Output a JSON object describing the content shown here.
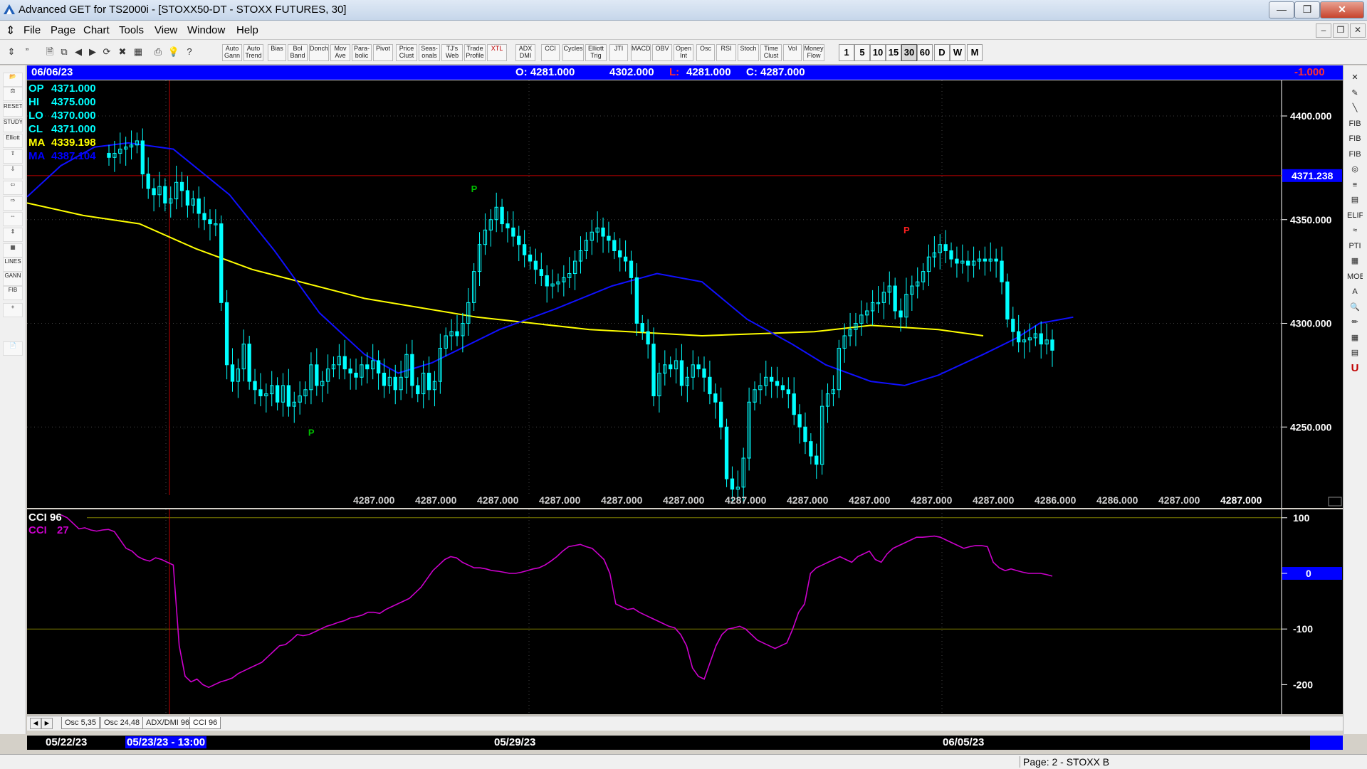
{
  "window": {
    "title": "Advanced GET for TS2000i - [STOXX50-DT - STOXX FUTURES, 30]",
    "minimize": "—",
    "restore": "❒",
    "close": "✕"
  },
  "menu": {
    "items": [
      "File",
      "Page",
      "Chart",
      "Tools",
      "View",
      "Window",
      "Help"
    ],
    "mdi_buttons": [
      "–",
      "❒",
      "✕"
    ]
  },
  "toolbar": {
    "study_buttons": [
      "Auto Gann",
      "Auto Trend",
      "Bias",
      "Bol Band",
      "Donch",
      "Mov Ave",
      "Para- bolic",
      "Pivot",
      "Price Clust",
      "Seas- onals",
      "TJ's Web",
      "Trade Profile",
      "XTL",
      "ADX DMI",
      "CCI",
      "Cycles",
      "Elliott Trig",
      "JTI",
      "MACD",
      "OBV",
      "Open Int",
      "Osc",
      "RSI",
      "Stoch",
      "Time Clust",
      "Vol",
      "Money Flow"
    ],
    "periods": [
      "1",
      "5",
      "10",
      "15",
      "30",
      "60",
      "D",
      "W",
      "M"
    ],
    "selected_period": "30"
  },
  "left_tools": [
    "📂",
    "⚖",
    "RESET",
    "STUDY",
    "Elliott",
    "⇧",
    "⇩",
    "⇦",
    "⇨",
    "⇔",
    "⇕",
    "▦",
    "LINES",
    "GANN",
    "FIB",
    "+",
    "📄"
  ],
  "right_tools": [
    "✕",
    "✎",
    "╲",
    "FIB RET",
    "FIB EXT",
    "FIB TIME",
    "◎",
    "≡",
    "▤",
    "ELIPS",
    "≈",
    "PTI",
    "▦",
    "MOB",
    "A",
    "🔍",
    "✏",
    "▦",
    "▤",
    "U"
  ],
  "infobar": {
    "date": "06/06/23",
    "open": "O: 4281.000",
    "high": "4302.000",
    "low_label": "L:",
    "low": "4281.000",
    "close": "C: 4287.000",
    "change": "-1.000"
  },
  "legend": [
    {
      "label": "OP",
      "value": "4371.000",
      "color": "#00ffff"
    },
    {
      "label": "HI",
      "value": "4375.000",
      "color": "#00ffff"
    },
    {
      "label": "LO",
      "value": "4370.000",
      "color": "#00ffff"
    },
    {
      "label": "CL",
      "value": "4371.000",
      "color": "#00ffff"
    },
    {
      "label": "MA",
      "value": "4339.198",
      "color": "#ffff00"
    },
    {
      "label": "MA",
      "value": "4387.104",
      "color": "#0000ff"
    }
  ],
  "colors": {
    "candle": "#00ffff",
    "ma_slow": "#ffff00",
    "ma_fast": "#1010ff",
    "cci": "#cc00cc",
    "pivot_low": "#00c000",
    "pivot_high": "#ff2020",
    "cursor": "#c00000",
    "grid": "#444444"
  },
  "price_axis": {
    "ticks": [
      "4400.000",
      "4350.000",
      "4300.000",
      "4250.000"
    ],
    "crosshair_label": "4371.238"
  },
  "bottom_values": [
    "4287.000",
    "4287.000",
    "4287.000",
    "4287.000",
    "4287.000",
    "4287.000",
    "4287.000",
    "4287.000",
    "4287.000",
    "4287.000",
    "4287.000",
    "4286.000",
    "4286.000",
    "4287.000",
    "4287.000"
  ],
  "pivots": {
    "low": "P",
    "high": "P"
  },
  "cci_panel": {
    "label1": "CCI 96",
    "label2": "CCI",
    "value2": "27",
    "ticks": [
      "100",
      "0",
      "-100",
      "-200"
    ],
    "zero_label": "0"
  },
  "tabs": {
    "nav_left": "◄",
    "nav_right": "►",
    "items": [
      "Osc 5,35",
      "Osc 24,48",
      "ADX/DMI 96",
      "CCI 96"
    ],
    "selected": "CCI 96"
  },
  "datebar": {
    "dates": [
      "05/22/23",
      "05/23/23 - 13:00",
      "05/29/23",
      "06/05/23"
    ]
  },
  "status": {
    "page": "Page: 2 - STOXX B"
  },
  "chart_data": {
    "type": "candlestick",
    "instrument": "STOXX50-DT",
    "ylim": [
      4210,
      4420
    ],
    "price_ticks": [
      4400,
      4350,
      4300,
      4250
    ],
    "crosshair_price": 4371.238,
    "closes": [
      4380,
      4382,
      4384,
      4385,
      4386,
      4388,
      4372,
      4365,
      4362,
      4366,
      4358,
      4360,
      4368,
      4364,
      4357,
      4360,
      4353,
      4350,
      4348,
      4348,
      4310,
      4280,
      4272,
      4278,
      4290,
      4272,
      4268,
      4265,
      4266,
      4270,
      4262,
      4270,
      4260,
      4262,
      4265,
      4268,
      4280,
      4270,
      4272,
      4278,
      4280,
      4284,
      4278,
      4276,
      4274,
      4280,
      4278,
      4282,
      4276,
      4270,
      4274,
      4268,
      4274,
      4285,
      4270,
      4266,
      4276,
      4268,
      4272,
      4288,
      4294,
      4296,
      4294,
      4300,
      4310,
      4325,
      4338,
      4345,
      4350,
      4356,
      4348,
      4346,
      4342,
      4338,
      4333,
      4330,
      4326,
      4323,
      4318,
      4319,
      4320,
      4322,
      4324,
      4330,
      4335,
      4340,
      4344,
      4346,
      4342,
      4340,
      4335,
      4332,
      4330,
      4322,
      4300,
      4296,
      4290,
      4265,
      4276,
      4280,
      4278,
      4282,
      4270,
      4274,
      4280,
      4278,
      4274,
      4266,
      4262,
      4250,
      4225,
      4220,
      4221,
      4235,
      4262,
      4268,
      4270,
      4274,
      4272,
      4270,
      4268,
      4266,
      4256,
      4250,
      4243,
      4236,
      4232,
      4260,
      4266,
      4268,
      4288,
      4294,
      4297,
      4300,
      4304,
      4306,
      4310,
      4310,
      4315,
      4318,
      4306,
      4303,
      4314,
      4318,
      4320,
      4325,
      4332,
      4334,
      4338,
      4335,
      4331,
      4329,
      4330,
      4328,
      4330,
      4331,
      4330,
      4331,
      4330,
      4320,
      4302,
      4296,
      4291,
      4292,
      4293,
      4295,
      4290,
      4292,
      4287
    ],
    "ma_slow": {
      "name": "MA",
      "last": 4339.198
    },
    "ma_fast": {
      "name": "MA",
      "last": 4387.104
    },
    "pivot_lows": [
      {
        "bar": 36,
        "price": 4252
      },
      {
        "bar": 110,
        "price": 4214
      }
    ],
    "pivot_highs": [
      {
        "bar": 65,
        "price": 4362
      },
      {
        "bar": 142,
        "price": 4342
      }
    ],
    "cci": {
      "name": "CCI",
      "period": 96,
      "last": 27,
      "ylim": [
        -215,
        130
      ],
      "levels": [
        100,
        -100
      ],
      "values": [
        105,
        100,
        90,
        80,
        82,
        78,
        76,
        78,
        79,
        75,
        60,
        45,
        40,
        30,
        25,
        22,
        28,
        25,
        20,
        15,
        -130,
        -185,
        -195,
        -190,
        -200,
        -205,
        -200,
        -195,
        -192,
        -188,
        -180,
        -175,
        -170,
        -165,
        -160,
        -150,
        -140,
        -130,
        -128,
        -120,
        -110,
        -112,
        -110,
        -105,
        -100,
        -95,
        -92,
        -88,
        -85,
        -80,
        -78,
        -75,
        -70,
        -70,
        -72,
        -65,
        -60,
        -55,
        -50,
        -45,
        -35,
        -25,
        -10,
        5,
        15,
        25,
        30,
        28,
        20,
        15,
        10,
        10,
        8,
        5,
        4,
        2,
        0,
        0,
        2,
        5,
        8,
        10,
        15,
        22,
        30,
        40,
        48,
        50,
        52,
        48,
        45,
        35,
        25,
        0,
        -55,
        -60,
        -65,
        -63,
        -70,
        -75,
        -80,
        -85,
        -90,
        -95,
        -98,
        -110,
        -130,
        -170,
        -185,
        -190,
        -160,
        -130,
        -110,
        -100,
        -98,
        -95,
        -100,
        -110,
        -120,
        -125,
        -130,
        -135,
        -130,
        -125,
        -100,
        -70,
        -55,
        0,
        10,
        15,
        20,
        25,
        30,
        25,
        20,
        30,
        35,
        40,
        25,
        20,
        35,
        45,
        50,
        55,
        60,
        65,
        65,
        66,
        67,
        65,
        60,
        55,
        50,
        45,
        48,
        50,
        50,
        48,
        20,
        10,
        5,
        8,
        5,
        2,
        0,
        0,
        0,
        -2,
        -5
      ]
    },
    "date_labels": [
      "05/22/23",
      "05/23/23 - 13:00",
      "05/29/23",
      "06/05/23"
    ]
  }
}
